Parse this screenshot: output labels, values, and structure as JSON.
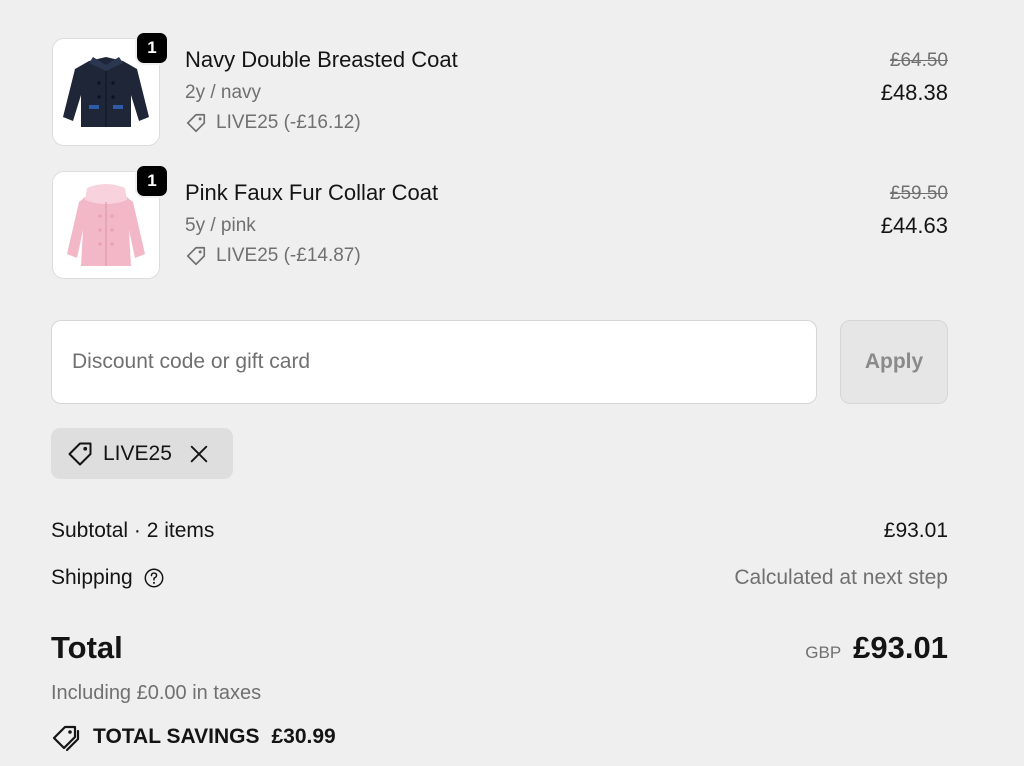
{
  "cart": {
    "items": [
      {
        "quantity": "1",
        "name": "Navy Double Breasted Coat",
        "variant": "2y / navy",
        "discount": "LIVE25 (-£16.12)",
        "original_price": "£64.50",
        "price": "£48.38",
        "thumb_color": "#1e2538"
      },
      {
        "quantity": "1",
        "name": "Pink Faux Fur Collar Coat",
        "variant": "5y / pink",
        "discount": "LIVE25 (-£14.87)",
        "original_price": "£59.50",
        "price": "£44.63",
        "thumb_color": "#f2b8c8"
      }
    ]
  },
  "discount": {
    "placeholder": "Discount code or gift card",
    "apply_label": "Apply",
    "applied_code": "LIVE25"
  },
  "summary": {
    "subtotal_label": "Subtotal · 2 items",
    "subtotal_value": "£93.01",
    "shipping_label": "Shipping",
    "shipping_value": "Calculated at next step",
    "total_label": "Total",
    "currency": "GBP",
    "total_value": "£93.01",
    "taxes": "Including £0.00 in taxes",
    "savings_label": "TOTAL SAVINGS",
    "savings_value": "£30.99"
  },
  "colors": {
    "background": "#efefef",
    "text": "#141414",
    "muted": "#707070",
    "badge": "#000000"
  }
}
